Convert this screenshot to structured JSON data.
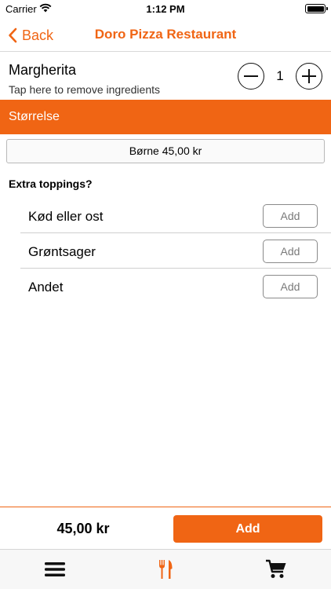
{
  "status_bar": {
    "carrier": "Carrier",
    "time": "1:12 PM"
  },
  "nav": {
    "back_label": "Back",
    "title": "Doro Pizza Restaurant"
  },
  "item": {
    "name": "Margherita",
    "hint": "Tap here to remove ingredients",
    "quantity": "1"
  },
  "size_section": {
    "title": "Størrelse",
    "selected": "Børne  45,00 kr"
  },
  "toppings": {
    "label": "Extra toppings?",
    "items": [
      {
        "label": "Kød eller ost",
        "button": "Add"
      },
      {
        "label": "Grøntsager",
        "button": "Add"
      },
      {
        "label": "Andet",
        "button": "Add"
      }
    ]
  },
  "footer": {
    "total": "45,00 kr",
    "add_label": "Add"
  },
  "tab_bar": {
    "items": [
      "menu-icon",
      "restaurant-icon",
      "cart-icon"
    ],
    "active": "restaurant-icon"
  },
  "colors": {
    "accent": "#f06514",
    "tab_inactive": "#111111"
  }
}
